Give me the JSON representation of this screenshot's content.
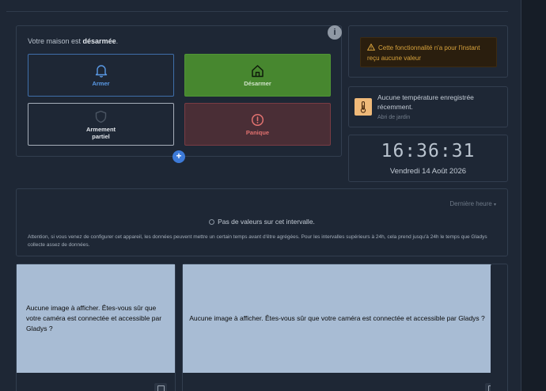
{
  "alarm": {
    "status_prefix": "Votre maison est ",
    "status_value": "désarmée",
    "status_suffix": ".",
    "info_icon": "i",
    "buttons": {
      "arm": "Armer",
      "disarm": "Désarmer",
      "partial": "Armement partiel",
      "panic": "Panique"
    },
    "add_label": "+",
    "colors": {
      "arm": "#5a9ae6",
      "disarm": "#47872f",
      "panic": "#e0716f"
    }
  },
  "warning": {
    "icon": "warning-triangle-icon",
    "text": "Cette fonctionnalité n'a pour l'instant reçu aucune valeur"
  },
  "temperature": {
    "icon": "thermometer-icon",
    "text": "Aucune température enregistrée récemment.",
    "room": "Abri de jardin"
  },
  "clock": {
    "time": "16:36:31",
    "date": "Vendredi 14 Août 2026"
  },
  "chart": {
    "period_label": "Dernière heure",
    "no_values": "Pas de valeurs sur cet intervalle.",
    "attention": "Attention, si vous venez de configurer cet appareil, les données peuvent mettre un certain temps avant d'être agrégées. Pour les intervalles supérieurs à 24h, cela prend jusqu'à 24h le temps que Gladys collecte assez de données."
  },
  "cameras": [
    {
      "message": "Aucune image à afficher. Êtes-vous sûr que votre caméra est connectée et accessible par Gladys ?",
      "icon": "camera-icon"
    },
    {
      "message": "Aucune image à afficher. Êtes-vous sûr que votre caméra est connectée et accessible par Gladys ?",
      "icon": "camera-icon"
    }
  ]
}
